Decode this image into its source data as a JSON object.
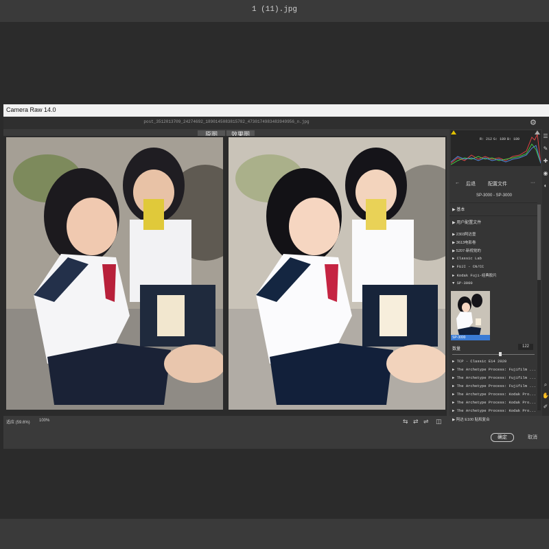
{
  "window": {
    "file_title": "1 (11).jpg"
  },
  "dialog": {
    "title": "Camera Raw 14.0",
    "raw_filename": "post_3512013709_24274692_1890145083815782_4730174983483949956_n.jpg",
    "tabs": {
      "original": "原图",
      "result": "效果图"
    },
    "zoom_select": "适应 (59.6%)",
    "zoom_value": "100%",
    "ok_label": "确定",
    "cancel_label": "取消"
  },
  "histogram": {
    "r_label": "R: 212",
    "g_label": "G: 189",
    "b_label": "B: 180"
  },
  "panel": {
    "back_label": "后退",
    "profile_header": "配置文件",
    "profile_name": "SP-3000 - SP-3000",
    "section_basic": "基本",
    "section_user": "用户配置文件",
    "groups": [
      "2303阿达壹",
      "3613电影卷",
      "5207-新视觉的",
      "Classic Lab",
      "FUJI - CN/CC",
      "Kodak Fuji-经典胶片",
      "SP-3000"
    ],
    "selected_thumb_label": "SP-3000",
    "amount_label": "数量",
    "amount_value": "122",
    "lower_groups": [
      "TCP - Classic E14 2020",
      "The Archetype Process: Fujifilm ...",
      "The Archetype Process: Fujifilm ...",
      "The Archetype Process: Fujifilm ...",
      "The Archetype Process: Kodak Pro...",
      "The Archetype Process: Kodak Pro...",
      "The Archetype Process: Kodak Pro...",
      "阿达 E100 贴和复合"
    ]
  },
  "colors": {
    "accent": "#3a7bd5",
    "dialog_bg": "#3a3a3a",
    "panel_bg": "#353535"
  }
}
